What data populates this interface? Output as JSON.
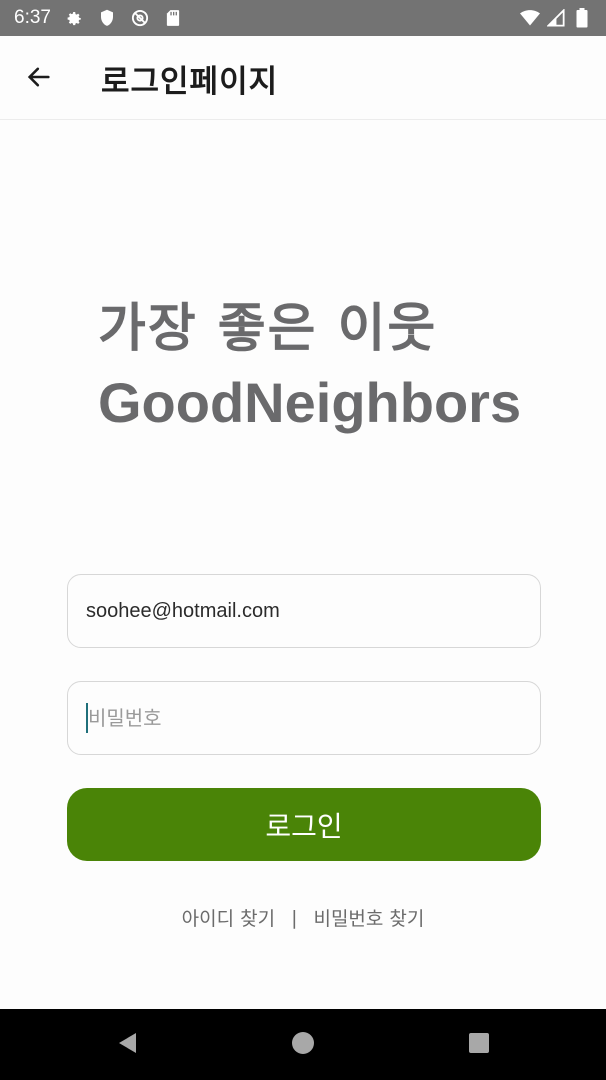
{
  "status_bar": {
    "time": "6:37",
    "icons_left": [
      "gear-icon",
      "shield-icon",
      "at-sign-icon",
      "sd-card-icon"
    ],
    "icons_right": [
      "wifi-icon",
      "signal-icon",
      "battery-icon"
    ],
    "background": "#737373"
  },
  "app_bar": {
    "title": "로그인페이지",
    "back_icon": "arrow-left-icon"
  },
  "headline": {
    "line1": "가장 좋은 이웃",
    "line2": "GoodNeighbors",
    "color": "#6a6a6c"
  },
  "form": {
    "email_value": "soohee@hotmail.com",
    "password_placeholder": "비밀번호",
    "password_value": "",
    "login_label": "로그인",
    "login_color": "#4a8407"
  },
  "links": {
    "find_id": "아이디 찾기",
    "separator": "|",
    "find_password": "비밀번호 찾기"
  },
  "nav_bar": {
    "buttons": [
      "back-triangle-icon",
      "home-circle-icon",
      "recents-square-icon"
    ]
  }
}
